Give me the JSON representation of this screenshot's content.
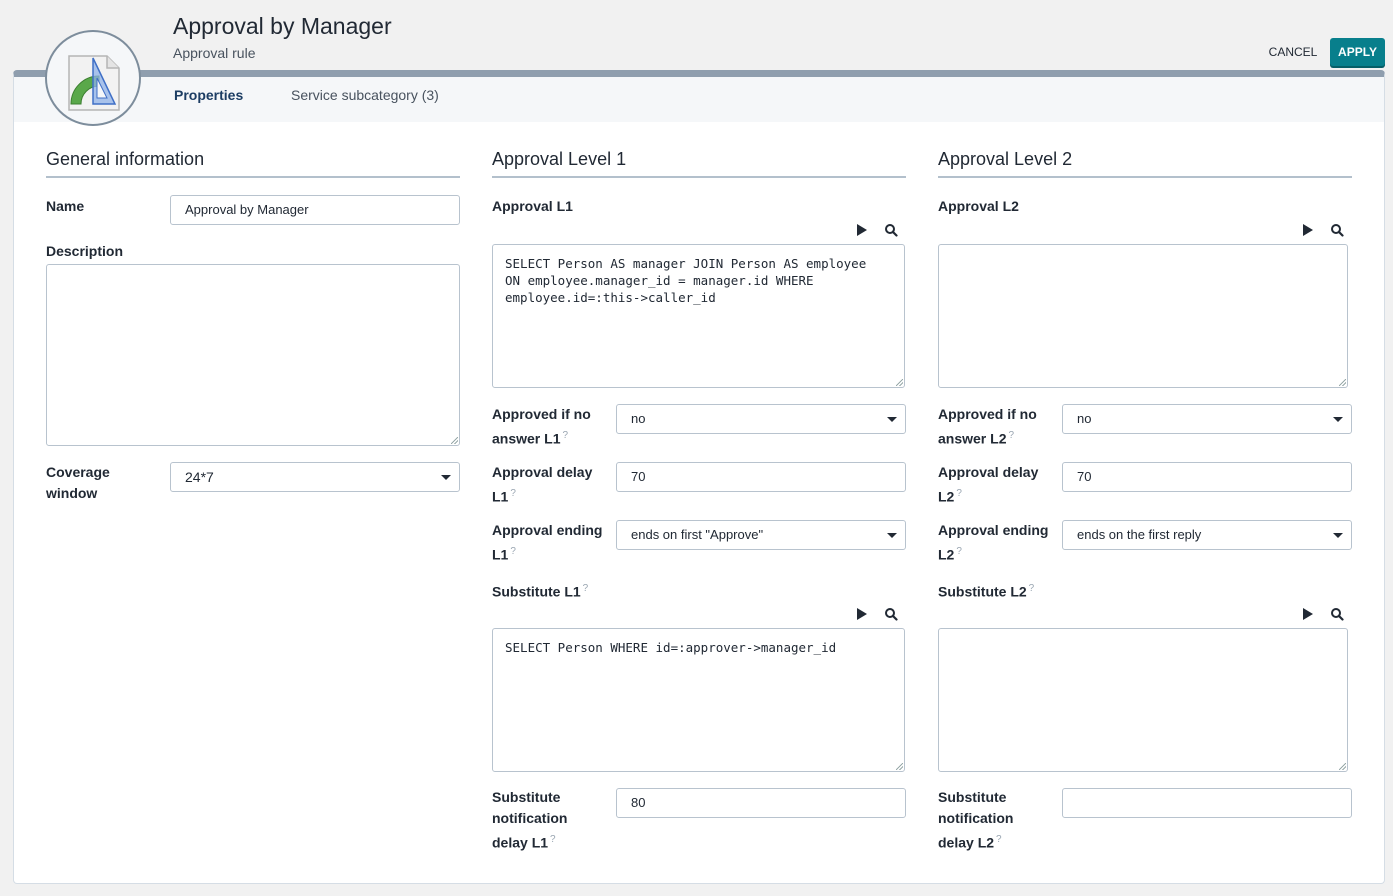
{
  "header": {
    "title": "Approval by Manager",
    "subtitle": "Approval rule",
    "cancel_label": "CANCEL",
    "apply_label": "APPLY",
    "object_icon": "approval-rule-icon"
  },
  "tabs": [
    {
      "label": "Properties",
      "active": true
    },
    {
      "label": "Service subcategory (3)",
      "active": false
    }
  ],
  "general": {
    "title": "General information",
    "name_label": "Name",
    "name_value": "Approval by Manager",
    "description_label": "Description",
    "description_value": "",
    "coverage_label_1": "Coverage",
    "coverage_label_2": "window",
    "coverage_value": "24*7"
  },
  "level1": {
    "title": "Approval Level 1",
    "approval_label": "Approval L1",
    "approval_query": "SELECT Person AS manager JOIN Person AS employee\nON employee.manager_id = manager.id WHERE\nemployee.id=:this->caller_id",
    "no_answer_label_1": "Approved if no",
    "no_answer_label_2": "answer L1",
    "no_answer_value": "no",
    "delay_label_1": "Approval delay",
    "delay_label_2": "L1",
    "delay_value": "70",
    "ending_label_1": "Approval ending",
    "ending_label_2": "L1",
    "ending_value": "ends on first \"Approve\"",
    "substitute_label": "Substitute L1",
    "substitute_query": "SELECT Person WHERE id=:approver->manager_id",
    "sub_delay_label_1": "Substitute",
    "sub_delay_label_2": "notification",
    "sub_delay_label_3": "delay L1",
    "sub_delay_value": "80"
  },
  "level2": {
    "title": "Approval Level 2",
    "approval_label": "Approval L2",
    "approval_query": "",
    "no_answer_label_1": "Approved if no",
    "no_answer_label_2": "answer L2",
    "no_answer_value": "no",
    "delay_label_1": "Approval delay",
    "delay_label_2": "L2",
    "delay_value": "70",
    "ending_label_1": "Approval ending",
    "ending_label_2": "L2",
    "ending_value": "ends on the first reply",
    "substitute_label": "Substitute L2",
    "substitute_query": "",
    "sub_delay_label_1": "Substitute",
    "sub_delay_label_2": "notification",
    "sub_delay_label_3": "delay L2",
    "sub_delay_value": ""
  },
  "help_glyph": "?",
  "colors": {
    "accent": "#087f8c",
    "active_tab": "#1c3d63",
    "card_top_border": "#8f9eae"
  }
}
